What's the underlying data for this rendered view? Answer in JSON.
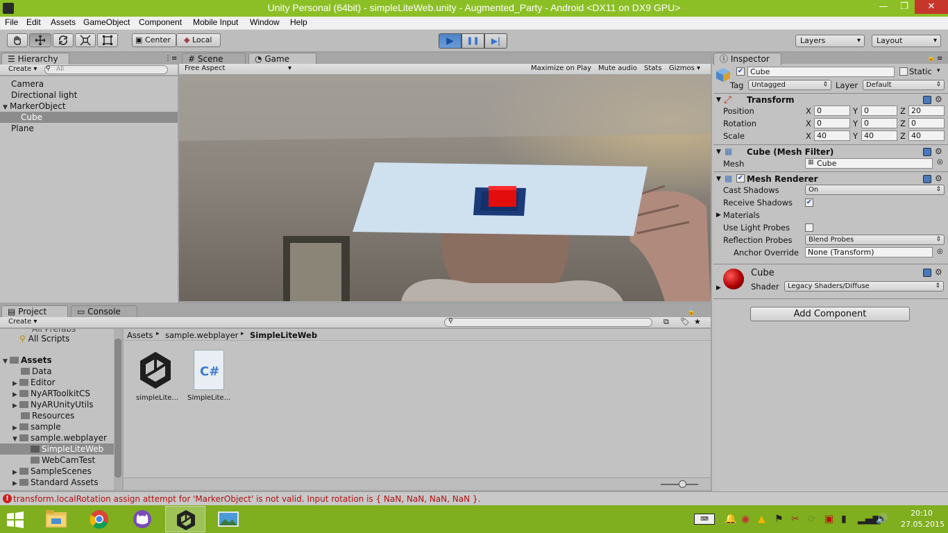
{
  "window": {
    "title": "Unity Personal (64bit) - simpleLiteWeb.unity - Augmented_Party - Android <DX11 on DX9 GPU>",
    "minimize": "—",
    "maximize": "❐",
    "close": "✕"
  },
  "menu": [
    "File",
    "Edit",
    "Assets",
    "GameObject",
    "Component",
    "Mobile Input",
    "Window",
    "Help"
  ],
  "toolbar": {
    "tools": [
      "hand-icon",
      "move-icon",
      "rotate-icon",
      "scale-icon",
      "rect-icon"
    ],
    "pivot": "Center",
    "space": "Local",
    "play": "▶",
    "pause": "❚❚",
    "step": "▶|",
    "layers": "Layers",
    "layout": "Layout"
  },
  "hierarchy": {
    "tab": "Hierarchy",
    "create": "Create",
    "search_placeholder": "All",
    "items": [
      "Camera",
      "Directional light",
      "MarkerObject",
      "Cube",
      "Plane"
    ]
  },
  "scene_tab": "Scene",
  "game": {
    "tab": "Game",
    "aspect": "Free Aspect",
    "options": [
      "Maximize on Play",
      "Mute audio",
      "Stats",
      "Gizmos"
    ]
  },
  "project": {
    "tab": "Project",
    "console_tab": "Console",
    "create": "Create",
    "tree": {
      "partial_top": "All Prefabs",
      "all_scripts": "All Scripts",
      "assets": "Assets",
      "folders": [
        "Data",
        "Editor",
        "NyARToolkitCS",
        "NyARUnityUtils",
        "Resources",
        "sample",
        "sample.webplayer",
        "SimpleLiteWeb",
        "WebCamTest",
        "SampleScenes",
        "Standard Assets"
      ]
    },
    "breadcrumb": [
      "Assets",
      "sample.webplayer",
      "SimpleLiteWeb"
    ],
    "files": [
      {
        "label": "simpleLite...",
        "icon": "unity-scene-icon"
      },
      {
        "label": "SimpleLite...",
        "icon": "csharp-script-icon"
      }
    ],
    "cs_glyph": "C#"
  },
  "inspector": {
    "tab": "Inspector",
    "object_name": "Cube",
    "static_label": "Static",
    "tag_label": "Tag",
    "tag_value": "Untagged",
    "layer_label": "Layer",
    "layer_value": "Default",
    "transform": {
      "title": "Transform",
      "position_label": "Position",
      "rotation_label": "Rotation",
      "scale_label": "Scale",
      "axes": [
        "X",
        "Y",
        "Z"
      ],
      "position": [
        "0",
        "0",
        "20"
      ],
      "rotation": [
        "0",
        "0",
        "0"
      ],
      "scale": [
        "40",
        "40",
        "40"
      ]
    },
    "mesh_filter": {
      "title": "Cube (Mesh Filter)",
      "mesh_label": "Mesh",
      "mesh_value": "Cube"
    },
    "mesh_renderer": {
      "title": "Mesh Renderer",
      "cast_shadows_label": "Cast Shadows",
      "cast_shadows_value": "On",
      "receive_shadows_label": "Receive Shadows",
      "materials_label": "Materials",
      "light_probes_label": "Use Light Probes",
      "reflection_probes_label": "Reflection Probes",
      "reflection_probes_value": "Blend Probes",
      "anchor_label": "Anchor Override",
      "anchor_value": "None (Transform)"
    },
    "material": {
      "name": "Cube",
      "shader_label": "Shader",
      "shader_value": "Legacy Shaders/Diffuse"
    },
    "add_component": "Add Component"
  },
  "status": {
    "message": "transform.localRotation assign attempt for 'MarkerObject' is not valid. Input rotation is { NaN, NaN, NaN, NaN }."
  },
  "taskbar": {
    "apps": [
      "file-explorer-icon",
      "chrome-icon",
      "github-icon",
      "unity-icon",
      "photos-icon"
    ],
    "time": "20:10",
    "date": "27.05.2015"
  },
  "colors": {
    "titlebar": "#8cbf26",
    "taskbar": "#7fae1f",
    "accent": "#3e7ad1",
    "error": "#b01010"
  }
}
